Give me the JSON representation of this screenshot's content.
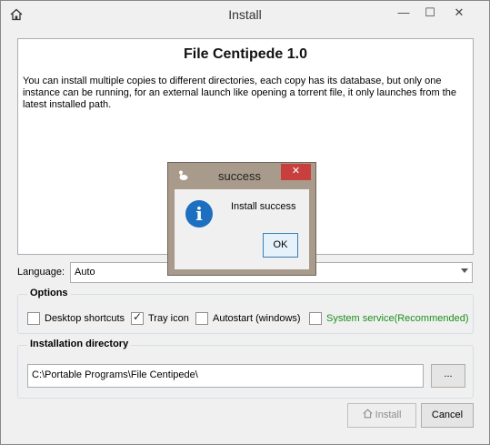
{
  "window": {
    "title": "Install",
    "minimize_glyph": "—",
    "maximize_glyph": "☐",
    "close_glyph": "✕",
    "icon": "home-icon"
  },
  "intro": {
    "heading": "File Centipede 1.0",
    "body": "You can install multiple copies to different directories, each copy has its database, but only one instance can be running, for an external launch like opening a torrent file, it only launches from the latest installed path."
  },
  "language": {
    "label": "Language:",
    "value": "Auto"
  },
  "options": {
    "title": "Options",
    "items": [
      {
        "label": "Desktop shortcuts",
        "checked": false
      },
      {
        "label": "Tray icon",
        "checked": true
      },
      {
        "label": "Autostart (windows)",
        "checked": false
      },
      {
        "label": "System service(Recommended)",
        "checked": false,
        "color": "#1c8f1c"
      }
    ]
  },
  "install_dir": {
    "title": "Installation directory",
    "path": "C:\\Portable Programs\\File Centipede\\",
    "browse_label": "..."
  },
  "buttons": {
    "install": "Install",
    "cancel": "Cancel"
  },
  "dialog": {
    "title": "success",
    "message": "Install success",
    "ok": "OK",
    "close_glyph": "✕",
    "icon": "info-icon",
    "info_glyph": "i"
  },
  "colors": {
    "dialog_frame": "#a99b8c",
    "close_red": "#c7403d",
    "info_blue": "#1d6fbf",
    "service_green": "#1c8f1c"
  }
}
